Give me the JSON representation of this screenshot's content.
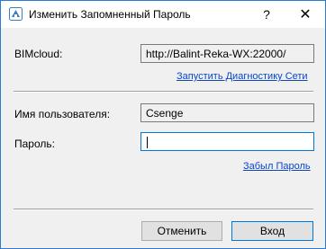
{
  "window": {
    "title": "Изменить Запомненный Пароль",
    "help_label": "?",
    "close_label": "✕"
  },
  "bimcloud": {
    "label": "BIMcloud:",
    "value": "http://Balint-Reka-WX:22000/",
    "diagnostics_link": "Запустить Диагностику Сети"
  },
  "credentials": {
    "username_label": "Имя пользователя:",
    "username_value": "Csenge",
    "password_label": "Пароль:",
    "password_value": "",
    "forgot_link": "Забыл Пароль"
  },
  "buttons": {
    "cancel": "Отменить",
    "login": "Вход"
  },
  "colors": {
    "border": "#2b7bd6",
    "link": "#0a46c8",
    "focus": "#0078d7"
  },
  "icons": {
    "app": "archicad-app-icon"
  }
}
